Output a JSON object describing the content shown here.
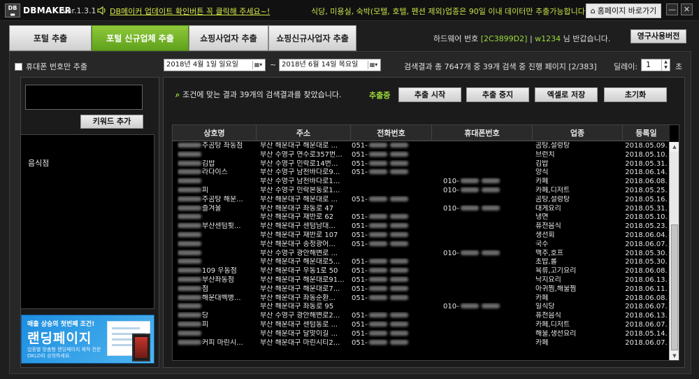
{
  "titlebar": {
    "logo": "DB",
    "app_name": "DBMAKER",
    "version": "Ver.1.3.1",
    "update_link": "DB메이커 업데이트 확인버튼 꼭 클릭해 주세요~!",
    "notice": "식당, 미용실, 숙박(모텔, 호텔, 펜션 제외)업종은 90일 이내 데이터만 추출가능합니다",
    "home_button": "홈페이지 바로가기",
    "minimize": "—",
    "close": "✕"
  },
  "tabs": [
    {
      "label": "포털 추출"
    },
    {
      "label": "포털 신규업체 추출"
    },
    {
      "label": "쇼핑사업자 추출"
    },
    {
      "label": "쇼핑신규사업자 추출"
    }
  ],
  "hardware": {
    "label": "하드웨어 번호",
    "id": "[2C3899D2]",
    "separator": "|",
    "user": "w1234",
    "greeting": "님 반갑습니다."
  },
  "permanent_button": "영구사용버전",
  "filters": {
    "mobile_only": "휴대폰 번호만 추출",
    "date_from": "2018년  4월  1일 일요일",
    "date_to": "2018년  6월 14일 목요일",
    "tilde": "~",
    "search_status": "검색결과 총 7647개 중 39개 검색 중 진행 페이지 [2/383]",
    "delay_label": "딜레이:",
    "delay_value": "1",
    "delay_unit": "초"
  },
  "keywords": {
    "add_button": "키워드 추가",
    "items": [
      "음식점"
    ]
  },
  "banner": {
    "line1a": "매출 상승의 첫번째 조건!",
    "title": "랜딩페이지",
    "line3": "업종별 맞춤형 랜딩페이지 제작 전문 OKLD와 상의하세요."
  },
  "results": {
    "found": "조건에 맞는 결과 39개의 검색결과를 찾았습니다.",
    "extract_status": "추출중",
    "buttons": [
      "추출 시작",
      "추출 중지",
      "엑셀로 저장",
      "초기화"
    ]
  },
  "table": {
    "columns": [
      "상호명",
      "주소",
      "전화번호",
      "휴대폰번호",
      "업종",
      "등록일"
    ],
    "rows": [
      {
        "name": "주곰탕 좌동점",
        "addr": "부산 해운대구 해운대로 ...",
        "tel": "051-",
        "mobile": "",
        "cat": "곰탕,설렁탕",
        "date": "2018.05.09."
      },
      {
        "name": "",
        "addr": "부산 수영구 연수로357번...",
        "tel": "051-",
        "mobile": "",
        "cat": "브런치",
        "date": "2018.05.10."
      },
      {
        "name": "김밥",
        "addr": "부산 수영구 민락로14번...",
        "tel": "051-",
        "mobile": "",
        "cat": "김밥",
        "date": "2018.05.31."
      },
      {
        "name": "라다이스",
        "addr": "부산 수영구 남천바다로9...",
        "tel": "051-",
        "mobile": "",
        "cat": "양식",
        "date": "2018.06.14."
      },
      {
        "name": "",
        "addr": "부산 수영구 남천바다로1...",
        "tel": "",
        "mobile": "010-",
        "cat": "카페",
        "date": "2018.06.08."
      },
      {
        "name": "피",
        "addr": "부산 수영구 민락본동로1...",
        "tel": "",
        "mobile": "010-",
        "cat": "카페,디저트",
        "date": "2018.05.25."
      },
      {
        "name": "주곰탕 해운...",
        "addr": "부산 해운대구 해운대로 ...",
        "tel": "051-",
        "mobile": "",
        "cat": "곰탕,설렁탕",
        "date": "2018.05.16."
      },
      {
        "name": "즐겨울",
        "addr": "부산 해운대구 좌동로 47",
        "tel": "",
        "mobile": "010-",
        "cat": "대게요리",
        "date": "2018.05.31."
      },
      {
        "name": "",
        "addr": "부산 해운대구 재반로 62",
        "tel": "051-",
        "mobile": "",
        "cat": "냉면",
        "date": "2018.05.10."
      },
      {
        "name": "부산센텀륏...",
        "addr": "부산 해운대구 센텀남대...",
        "tel": "051-",
        "mobile": "",
        "cat": "퓨전음식",
        "date": "2018.05.23."
      },
      {
        "name": "",
        "addr": "부산 해운대구 재반로 107",
        "tel": "051-",
        "mobile": "",
        "cat": "생선회",
        "date": "2018.06.04."
      },
      {
        "name": "",
        "addr": "부산 해운대구 송정광어...",
        "tel": "051-",
        "mobile": "",
        "cat": "국수",
        "date": "2018.06.07."
      },
      {
        "name": "",
        "addr": "부산 수영구 광안해변로 ...",
        "tel": "",
        "mobile": "010-",
        "cat": "맥주,호프",
        "date": "2018.05.30."
      },
      {
        "name": "",
        "addr": "부산 해운대구 해운대로5...",
        "tel": "051-",
        "mobile": "",
        "cat": "초밥,롤",
        "date": "2018.05.30."
      },
      {
        "name": "109 우동점",
        "addr": "부산 해운대구 우동1로 50",
        "tel": "051-",
        "mobile": "",
        "cat": "육류,고기요리",
        "date": "2018.06.08."
      },
      {
        "name": "부산좌동점",
        "addr": "부산 해운대구 해운대로91...",
        "tel": "051-",
        "mobile": "",
        "cat": "낙지요리",
        "date": "2018.06.13."
      },
      {
        "name": "점",
        "addr": "부산 해운대구 해운대로7...",
        "tel": "051-",
        "mobile": "",
        "cat": "아귀찜,해물찜",
        "date": "2018.06.11."
      },
      {
        "name": "해운대벡병...",
        "addr": "부산 해운대구 좌동순환...",
        "tel": "051-",
        "mobile": "",
        "cat": "카페",
        "date": "2018.06.08."
      },
      {
        "name": "",
        "addr": "부산 해운대구 좌동로 95",
        "tel": "",
        "mobile": "010-",
        "cat": "일식당",
        "date": "2018.06.07."
      },
      {
        "name": "당",
        "addr": "부산 수영구 광안해변로2...",
        "tel": "051-",
        "mobile": "",
        "cat": "퓨전음식",
        "date": "2018.06.13."
      },
      {
        "name": "피",
        "addr": "부산 해운대구 센텀동로 ...",
        "tel": "051-",
        "mobile": "",
        "cat": "카페,디저트",
        "date": "2018.06.07."
      },
      {
        "name": "",
        "addr": "부산 해운대구 달맞이길 ...",
        "tel": "051-",
        "mobile": "",
        "cat": "해물,생선요리",
        "date": "2018.05.14."
      },
      {
        "name": "커피 마린시...",
        "addr": "부산 해운대구 마린시티2...",
        "tel": "051-",
        "mobile": "",
        "cat": "카페",
        "date": "2018.06.07."
      }
    ]
  }
}
